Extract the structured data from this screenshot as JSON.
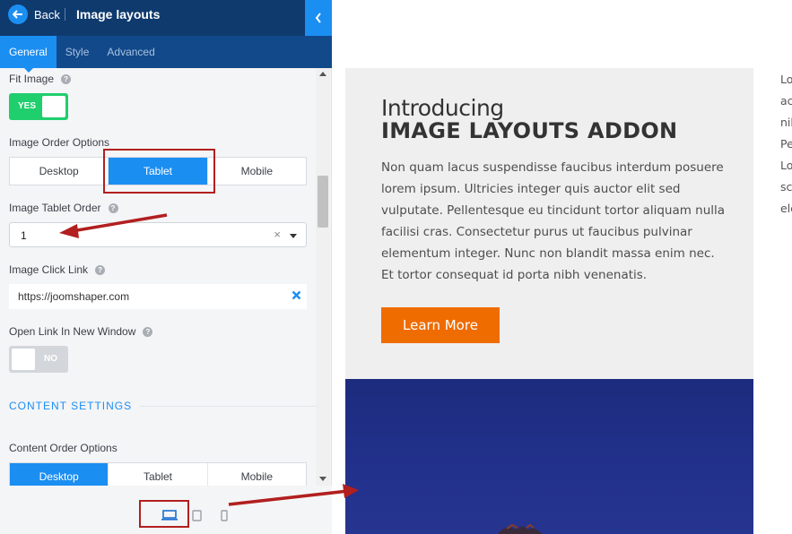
{
  "header": {
    "back_label": "Back",
    "title": "Image layouts"
  },
  "tabs": [
    {
      "label": "General",
      "active": true
    },
    {
      "label": "Style",
      "active": false
    },
    {
      "label": "Advanced",
      "active": false
    }
  ],
  "fields": {
    "fit_image": {
      "label": "Fit Image",
      "value": "YES",
      "on": true
    },
    "image_order": {
      "label": "Image Order Options",
      "options": [
        "Desktop",
        "Tablet",
        "Mobile"
      ],
      "selected": "Tablet"
    },
    "image_tablet_order": {
      "label": "Image Tablet Order",
      "value": "1",
      "clear": "×"
    },
    "image_click_link": {
      "label": "Image Click Link",
      "value": "https://joomshaper.com"
    },
    "open_new_window": {
      "label": "Open Link In New Window",
      "value": "NO",
      "on": false
    },
    "content_settings": {
      "heading": "CONTENT SETTINGS"
    },
    "content_order": {
      "label": "Content Order Options",
      "options": [
        "Desktop",
        "Tablet",
        "Mobile"
      ],
      "selected": "Desktop"
    }
  },
  "help_glyph": "?",
  "device_preview": [
    "laptop-icon",
    "tablet-icon",
    "mobile-icon"
  ],
  "preview": {
    "intro": "Introducing",
    "heading": "IMAGE LAYOUTS ADDON",
    "body": "Non quam lacus suspendisse faucibus interdum posuere lorem ipsum. Ultricies integer quis auctor elit sed vulputate. Pellentesque eu tincidunt tortor aliquam nulla facilisi cras. Consectetur purus ut faucibus pulvinar elementum integer. Nunc non blandit massa enim nec. Et tortor consequat id porta nibh venenatis.",
    "button": "Learn More",
    "side_lines": [
      "Lo",
      "ac",
      "nil",
      "Pe",
      "Lo",
      "sc",
      "ele"
    ]
  },
  "colors": {
    "accent": "#1b8ef2",
    "topbar": "#0e3a6e",
    "tabs": "#12498a",
    "toggle_on": "#1fce6d",
    "cta": "#ef6c00",
    "annotation": "#b21f1f"
  }
}
